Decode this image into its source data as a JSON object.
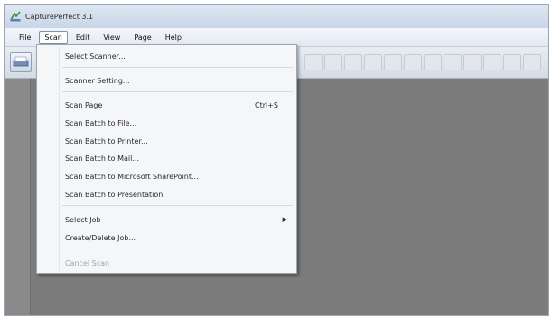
{
  "window": {
    "title": "CapturePerfect 3.1"
  },
  "menubar": {
    "items": [
      {
        "label": "File",
        "active": false
      },
      {
        "label": "Scan",
        "active": true
      },
      {
        "label": "Edit",
        "active": false
      },
      {
        "label": "View",
        "active": false
      },
      {
        "label": "Page",
        "active": false
      },
      {
        "label": "Help",
        "active": false
      }
    ]
  },
  "scan_menu": {
    "select_scanner": "Select Scanner...",
    "scanner_setting": "Scanner Setting...",
    "scan_page": "Scan Page",
    "scan_page_shortcut": "Ctrl+S",
    "scan_batch_to_file": "Scan Batch to File...",
    "scan_batch_to_printer": "Scan Batch to Printer...",
    "scan_batch_to_mail": "Scan Batch to Mail...",
    "scan_batch_to_sharepoint": "Scan Batch to Microsoft SharePoint...",
    "scan_batch_to_presentation": "Scan Batch to Presentation",
    "select_job": "Select Job",
    "create_delete_job": "Create/Delete Job...",
    "cancel_scan": "Cancel Scan"
  },
  "colors": {
    "workspace": "#7b7b7b",
    "menu_background": "#f5f6f8",
    "titlebar": "#d4deeb"
  }
}
